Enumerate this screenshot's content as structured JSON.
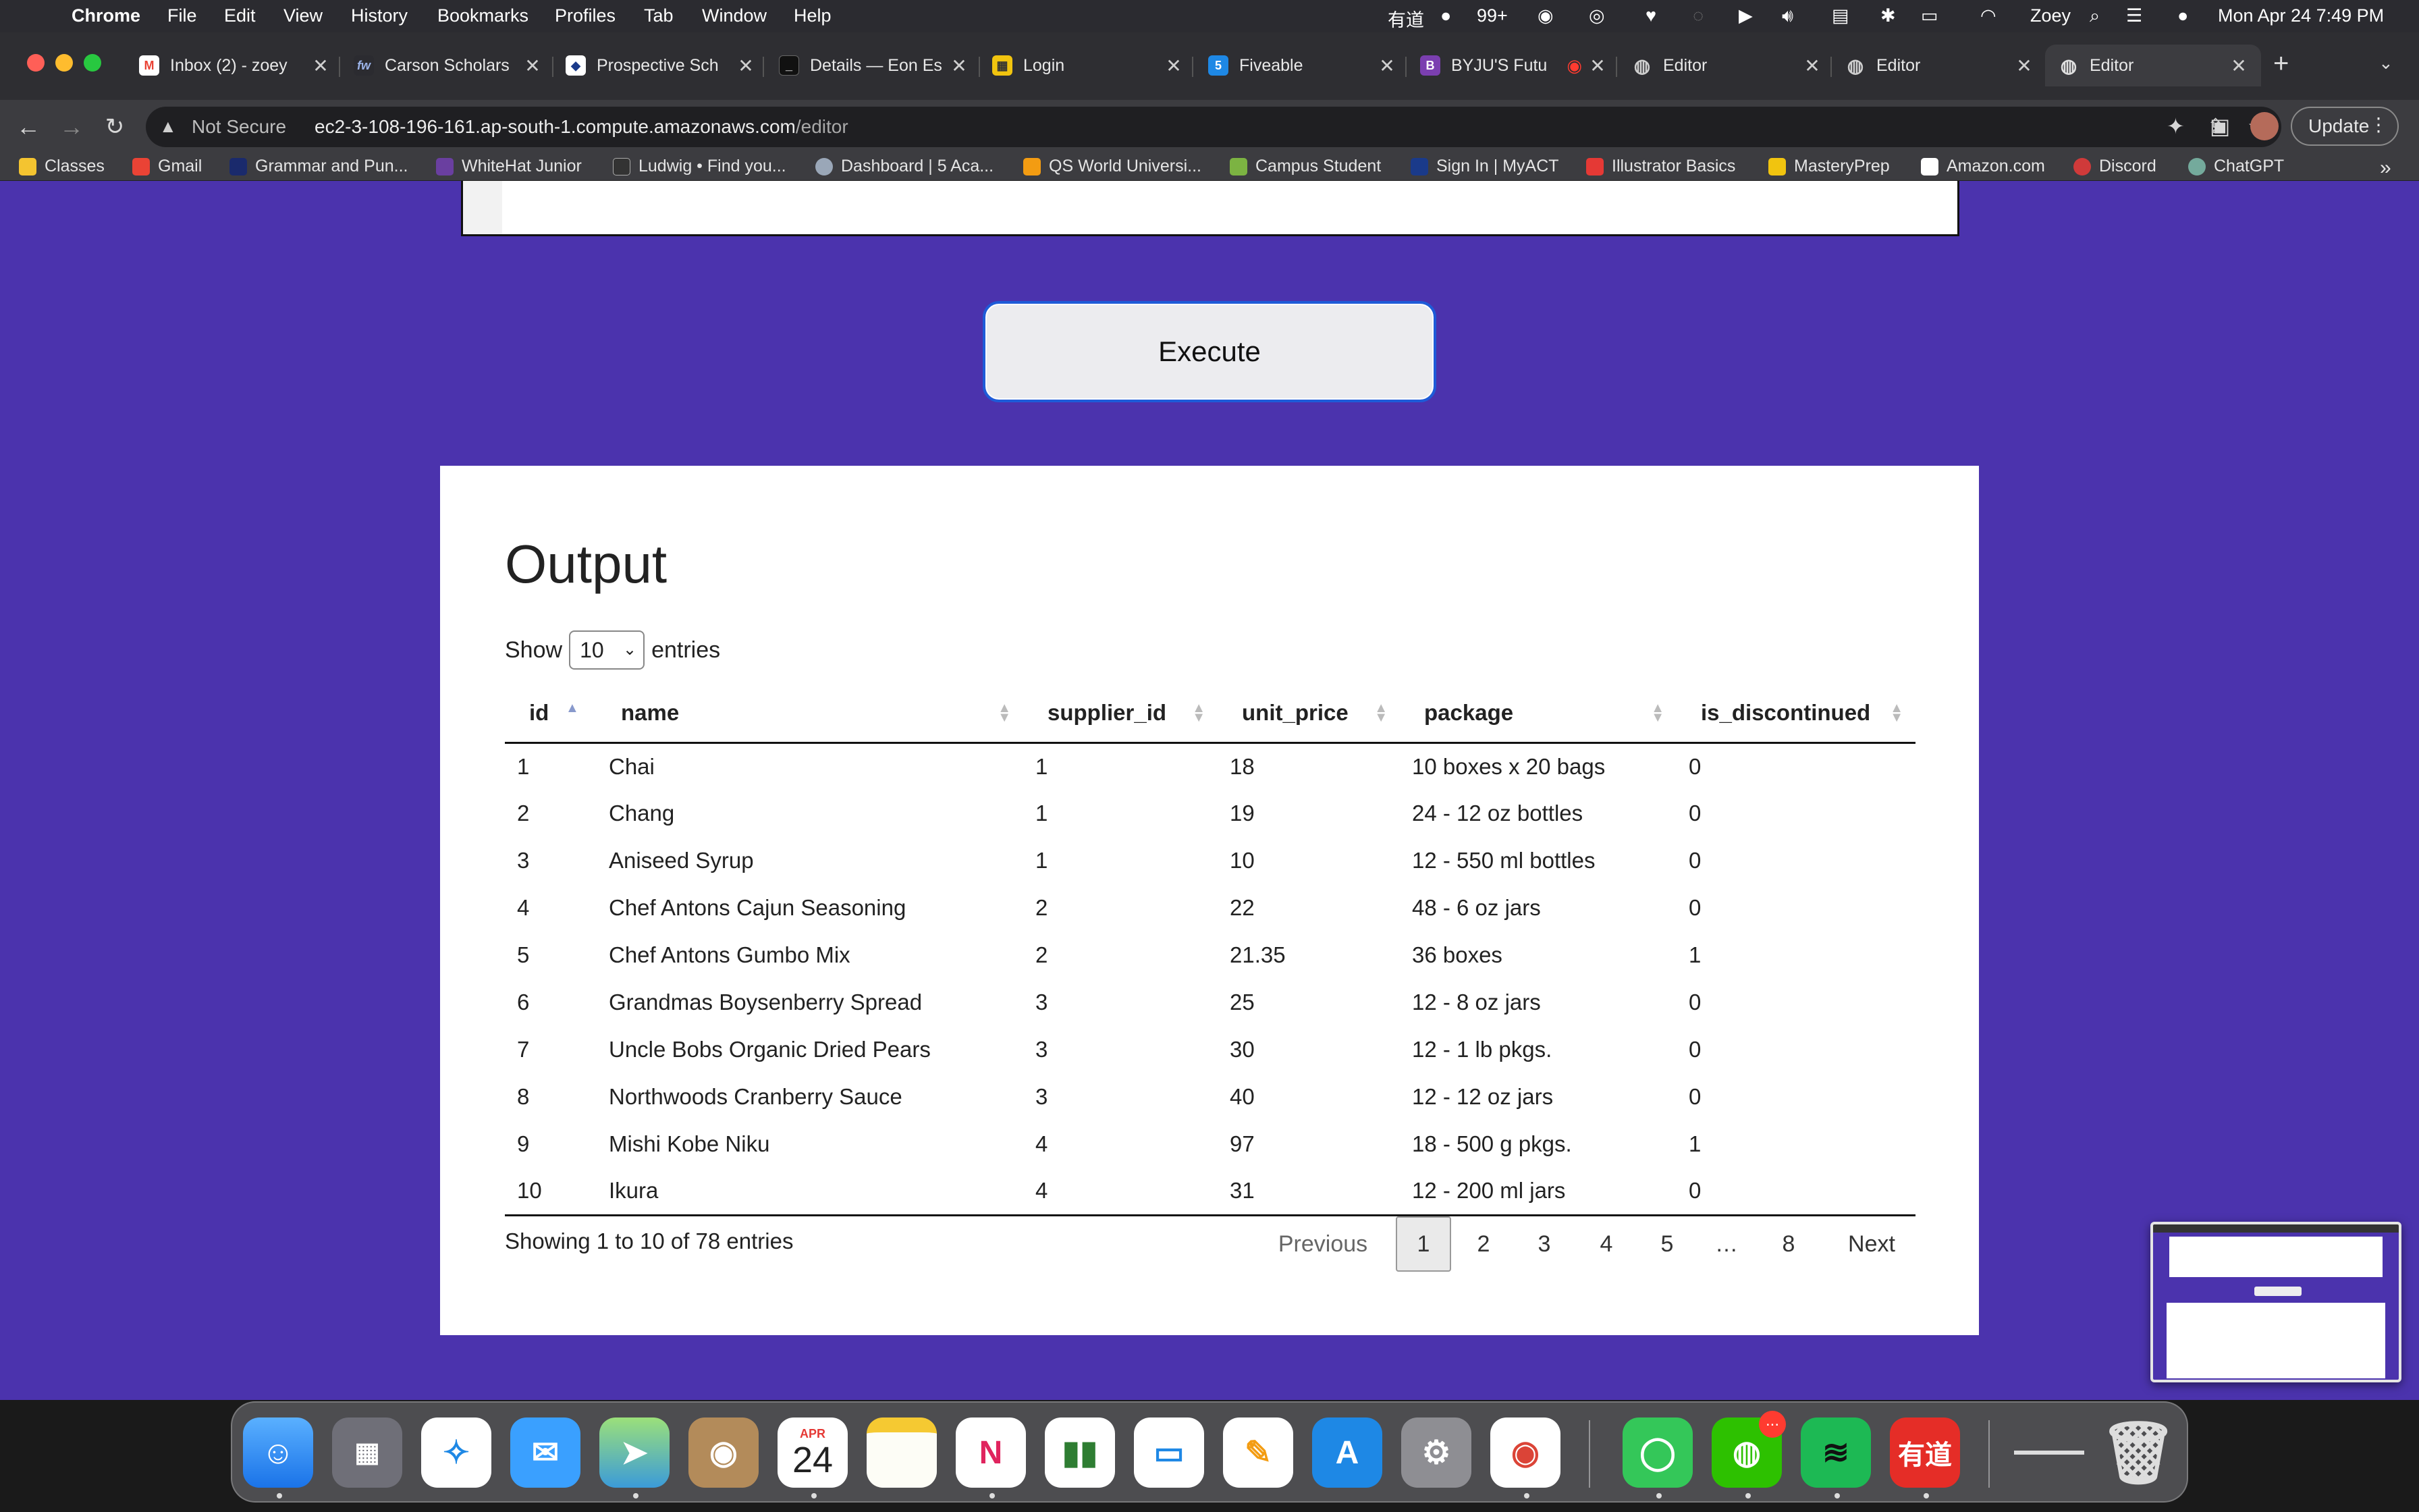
{
  "menubar": {
    "app": "Chrome",
    "items": [
      "File",
      "Edit",
      "View",
      "History",
      "Bookmarks",
      "Profiles",
      "Tab",
      "Window",
      "Help"
    ],
    "youdao": "有道",
    "wechat_count": "99+",
    "user": "Zoey",
    "datetime": "Mon Apr 24  7:49 PM"
  },
  "tabs": [
    {
      "title": "Inbox (2) - zoey",
      "icon": "gmail-icon",
      "color": "#ffffff"
    },
    {
      "title": "Carson Scholars",
      "icon": "fw-icon",
      "color": "#2b2b30"
    },
    {
      "title": "Prospective Sch",
      "icon": "school-icon",
      "color": "#ffffff"
    },
    {
      "title": "Details — Eon Es",
      "icon": "eon-icon",
      "color": "#111111"
    },
    {
      "title": "Login",
      "icon": "login-icon",
      "color": "#f1c40f"
    },
    {
      "title": "Fiveable",
      "icon": "fiveable-icon",
      "color": "#1e88e5"
    },
    {
      "title": "BYJU'S Futu",
      "icon": "byjus-icon",
      "color": "#7b3fb0"
    },
    {
      "title": "Editor",
      "icon": "globe-icon",
      "color": "#9e9e9e"
    },
    {
      "title": "Editor",
      "icon": "globe-icon",
      "color": "#9e9e9e"
    },
    {
      "title": "Editor",
      "icon": "globe-icon",
      "color": "#9e9e9e"
    }
  ],
  "omnibox": {
    "security": "Not Secure",
    "host": "ec2-3-108-196-161.ap-south-1.compute.amazonaws.com",
    "path": "/editor"
  },
  "update_label": "Update",
  "bookmarks": [
    {
      "label": "Classes",
      "color": "#f4c430"
    },
    {
      "label": "Gmail",
      "color": "#ea4335"
    },
    {
      "label": "Grammar and Pun...",
      "color": "#1a2a6c"
    },
    {
      "label": "WhiteHat Junior",
      "color": "#6a3fa0"
    },
    {
      "label": "Ludwig • Find you...",
      "color": "#333333"
    },
    {
      "label": "Dashboard | 5 Aca...",
      "color": "#9aa7b8"
    },
    {
      "label": "QS World Universi...",
      "color": "#f39c12"
    },
    {
      "label": "Campus Student",
      "color": "#7cb342"
    },
    {
      "label": "Sign In | MyACT",
      "color": "#1a3a8a"
    },
    {
      "label": "Illustrator Basics",
      "color": "#e53935"
    },
    {
      "label": "MasteryPrep",
      "color": "#f1c40f"
    },
    {
      "label": "Amazon.com",
      "color": "#ffffff"
    },
    {
      "label": "Discord",
      "color": "#d03a3a"
    },
    {
      "label": "ChatGPT",
      "color": "#74aa9c"
    }
  ],
  "bookmarks_more": "»",
  "execute_label": "Execute",
  "output": {
    "title": "Output",
    "show_prefix": "Show",
    "show_value": "10",
    "show_suffix": "entries",
    "columns": [
      "id",
      "name",
      "supplier_id",
      "unit_price",
      "package",
      "is_discontinued"
    ],
    "rows": [
      [
        "1",
        "Chai",
        "1",
        "18",
        "10 boxes x 20 bags",
        "0"
      ],
      [
        "2",
        "Chang",
        "1",
        "19",
        "24 - 12 oz bottles",
        "0"
      ],
      [
        "3",
        "Aniseed Syrup",
        "1",
        "10",
        "12 - 550 ml bottles",
        "0"
      ],
      [
        "4",
        "Chef Antons Cajun Seasoning",
        "2",
        "22",
        "48 - 6 oz jars",
        "0"
      ],
      [
        "5",
        "Chef Antons Gumbo Mix",
        "2",
        "21.35",
        "36 boxes",
        "1"
      ],
      [
        "6",
        "Grandmas Boysenberry Spread",
        "3",
        "25",
        "12 - 8 oz jars",
        "0"
      ],
      [
        "7",
        "Uncle Bobs Organic Dried Pears",
        "3",
        "30",
        "12 - 1 lb pkgs.",
        "0"
      ],
      [
        "8",
        "Northwoods Cranberry Sauce",
        "3",
        "40",
        "12 - 12 oz jars",
        "0"
      ],
      [
        "9",
        "Mishi Kobe Niku",
        "4",
        "97",
        "18 - 500 g pkgs.",
        "1"
      ],
      [
        "10",
        "Ikura",
        "4",
        "31",
        "12 - 200 ml jars",
        "0"
      ]
    ],
    "info": "Showing 1 to 10 of 78 entries",
    "pagination": {
      "previous": "Previous",
      "pages": [
        "1",
        "2",
        "3",
        "4",
        "5",
        "…",
        "8"
      ],
      "next": "Next",
      "current": "1"
    }
  },
  "dock": {
    "calendar_month": "APR",
    "calendar_day": "24",
    "youdao_label": "有道",
    "wechat_badge": "..."
  },
  "colors": {
    "page_bg": "#4b33ad",
    "execute_border": "#1e5bd8"
  }
}
